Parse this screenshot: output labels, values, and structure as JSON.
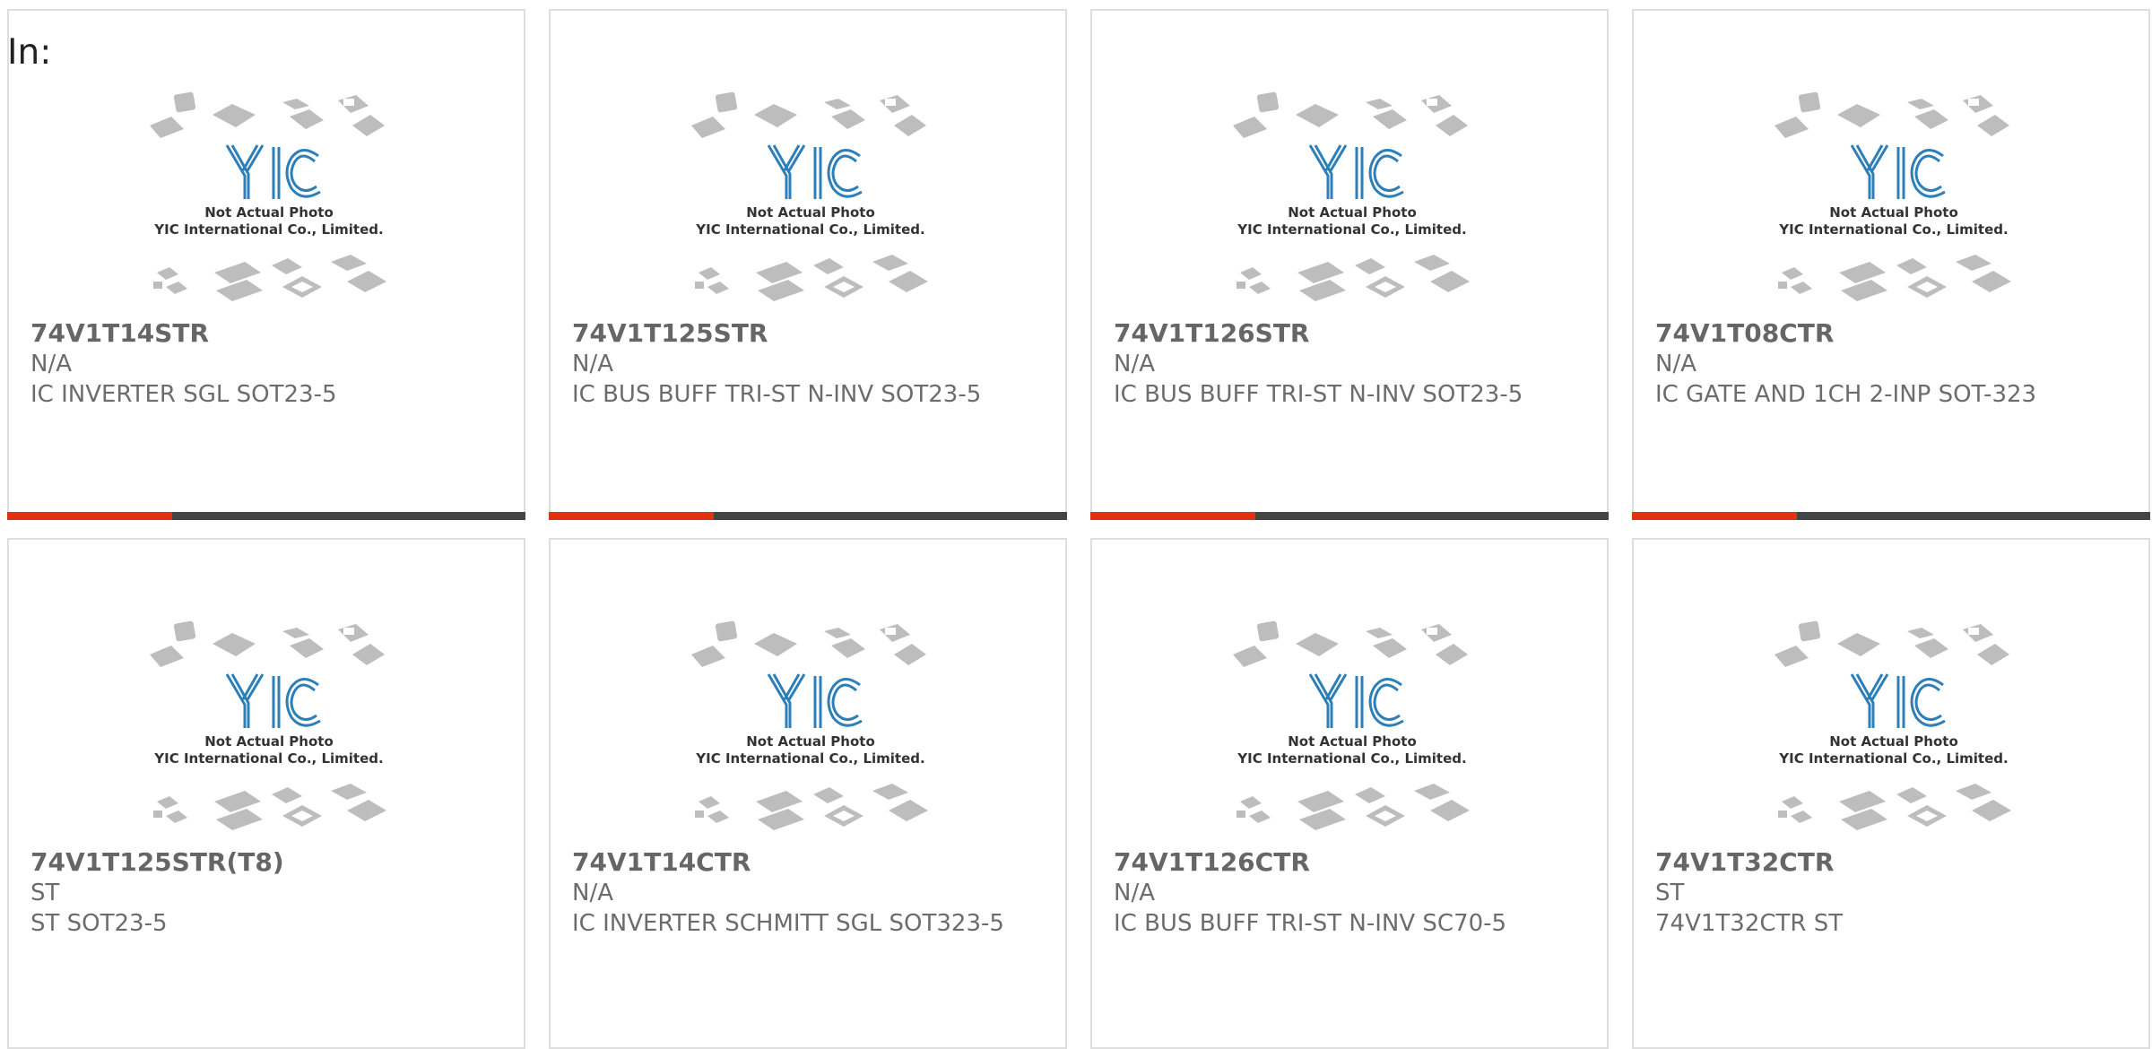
{
  "page": {
    "label": "In:"
  },
  "accent_color": "#e1330f",
  "bar_color": "#444444",
  "thumbnail": {
    "line1": "Not Actual Photo",
    "line2": "YIC International Co., Limited."
  },
  "products": [
    {
      "part": "74V1T14STR",
      "mfr": "N/A",
      "desc": "IC INVERTER SGL SOT23-5",
      "bar": true
    },
    {
      "part": "74V1T125STR",
      "mfr": "N/A",
      "desc": "IC BUS BUFF TRI-ST N-INV SOT23-5",
      "bar": true
    },
    {
      "part": "74V1T126STR",
      "mfr": "N/A",
      "desc": "IC BUS BUFF TRI-ST N-INV SOT23-5",
      "bar": true
    },
    {
      "part": "74V1T08CTR",
      "mfr": "N/A",
      "desc": "IC GATE AND 1CH 2-INP SOT-323",
      "bar": true
    },
    {
      "part": "74V1T125STR(T8)",
      "mfr": "ST",
      "desc": "ST SOT23-5",
      "bar": false
    },
    {
      "part": "74V1T14CTR",
      "mfr": "N/A",
      "desc": "IC INVERTER SCHMITT SGL SOT323-5",
      "bar": false
    },
    {
      "part": "74V1T126CTR",
      "mfr": "N/A",
      "desc": "IC BUS BUFF TRI-ST N-INV SC70-5",
      "bar": false
    },
    {
      "part": "74V1T32CTR",
      "mfr": "ST",
      "desc": "74V1T32CTR ST",
      "bar": false
    }
  ]
}
